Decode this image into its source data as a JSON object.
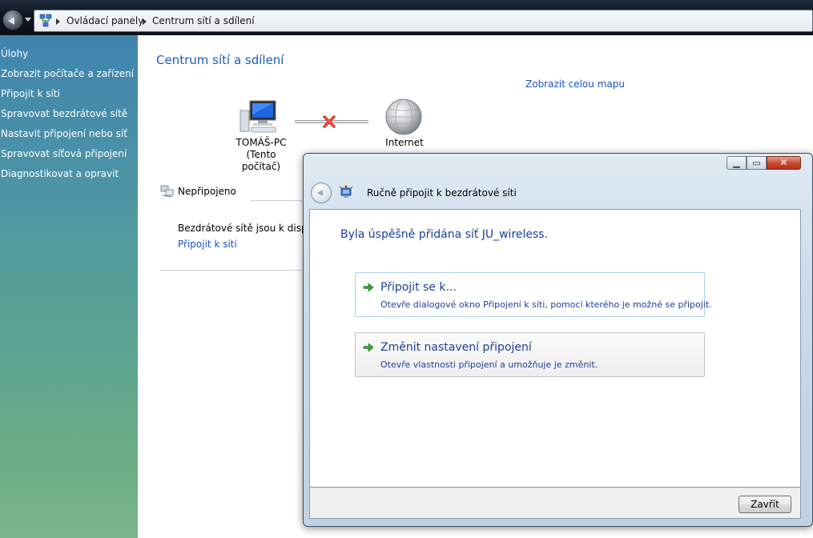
{
  "explorer": {
    "breadcrumb": [
      "Ovládací panely",
      "Centrum sítí a sdílení"
    ],
    "sidebar": {
      "heading": "Úlohy",
      "items": [
        {
          "label": "Zobrazit počítače a zařízení"
        },
        {
          "label": "Připojit k síti"
        },
        {
          "label": "Spravovat bezdrátové sítě"
        },
        {
          "label": "Nastavit připojení nebo síť"
        },
        {
          "label": "Spravovat síťová připojení"
        },
        {
          "label": "Diagnostikovat a opravit"
        }
      ]
    },
    "main": {
      "title": "Centrum sítí a sdílení",
      "full_map_link": "Zobrazit celou mapu",
      "computer_name": "TOMÁŠ-PC",
      "computer_note": "(Tento počítač)",
      "internet_label": "Internet",
      "status_label": "Nepřipojeno",
      "available_text": "Bezdrátové sítě jsou k dispozi",
      "connect_link": "Připojit k síti"
    }
  },
  "dialog": {
    "title": "Ručně připojit k bezdrátové síti",
    "heading": "Byla úspěšně přidána síť JU_wireless.",
    "options": [
      {
        "title": "Připojit se k...",
        "description": "Otevře dialogové okno Připojení k síti, pomocí kterého je možné se připojit."
      },
      {
        "title": "Změnit nastavení připojení",
        "description": "Otevře vlastnosti připojení a umožňuje je změnit."
      }
    ],
    "close_button": "Zavřít"
  },
  "icons": {
    "back": "back-arrow-icon",
    "network": "network-icon",
    "computer": "computer-icon",
    "disconnected": "red-x-icon",
    "globe": "globe-icon",
    "arrow": "green-arrow-icon"
  },
  "colors": {
    "link": "#1b52c7",
    "heading": "#1d3f9c",
    "sidebar_top": "#3f84ae",
    "sidebar_bottom": "#7ab48a",
    "close_button": "#c74a32"
  }
}
